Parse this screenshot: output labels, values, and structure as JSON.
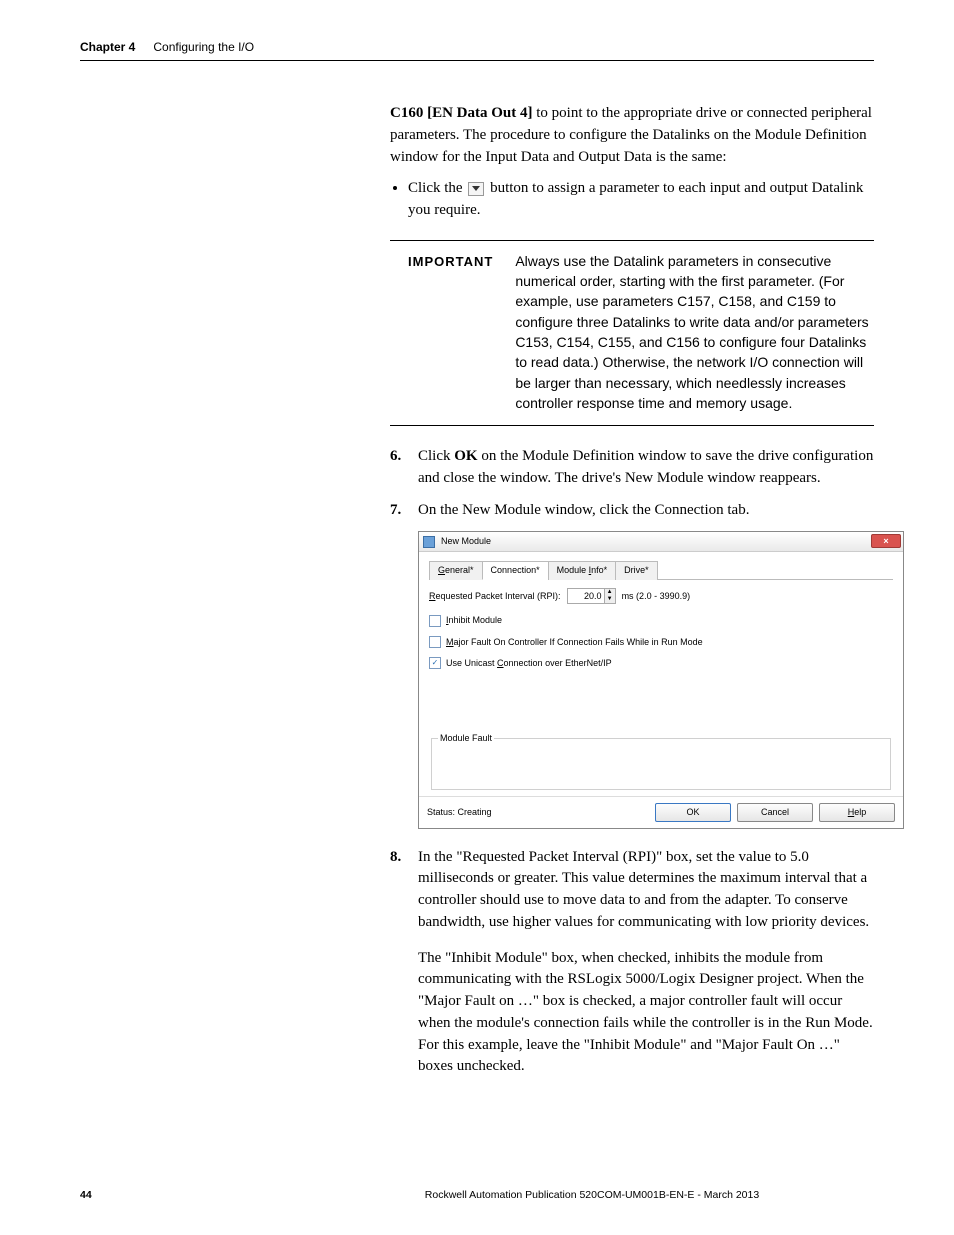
{
  "header": {
    "chapter": "Chapter 4",
    "title": "Configuring the I/O"
  },
  "intro": {
    "prefix": "C160 [EN Data Out 4]",
    "rest": " to point to the appropriate drive or connected peripheral parameters. The procedure to configure the Datalinks on the Module Definition window for the Input Data and Output Data is the same:"
  },
  "bullet": {
    "before": "Click the ",
    "after": " button to assign a parameter to each input and output Datalink you require."
  },
  "important": {
    "label": "IMPORTANT",
    "text": "Always use the Datalink parameters in consecutive numerical order, starting with the first parameter. (For example, use parameters C157, C158, and C159 to configure three Datalinks to write data and/or parameters C153, C154, C155, and C156 to configure four Datalinks to read data.) Otherwise, the network I/O connection will be larger than necessary, which needlessly increases controller response time and memory usage."
  },
  "steps": {
    "s6_before": "Click ",
    "s6_bold": "OK",
    "s6_after": " on the Module Definition window to save the drive configuration and close the window. The drive's New Module window reappears.",
    "s7": "On the New Module window, click the Connection tab.",
    "s8_p1": "In the \"Requested Packet Interval (RPI)\" box, set the value to 5.0 milliseconds or greater. This value determines the maximum interval that a controller should use to move data to and from the adapter. To conserve bandwidth, use higher values for communicating with low priority devices.",
    "s8_p2": "The \"Inhibit Module\" box, when checked, inhibits the module from communicating with the RSLogix 5000/Logix Designer project. When the \"Major Fault on …\" box is checked, a major controller fault will occur when the module's connection fails while the controller is in the Run Mode. For this example, leave the \"Inhibit Module\" and \"Major Fault On …\" boxes unchecked."
  },
  "dialog": {
    "title": "New Module",
    "tabs": {
      "t1": "General*",
      "t2": "Connection*",
      "t3": "Module Info*",
      "t4": "Drive*"
    },
    "rpi_label": "Requested Packet Interval (RPI):",
    "rpi_value": "20.0",
    "rpi_range": "ms (2.0 - 3990.9)",
    "inhibit": "Inhibit Module",
    "major": "Major Fault On Controller If Connection Fails While in Run Mode",
    "unicast": "Use Unicast Connection over EtherNet/IP",
    "fault_group": "Module Fault",
    "status": "Status: Creating",
    "ok": "OK",
    "cancel": "Cancel",
    "help": "Help",
    "close": "×"
  },
  "footer": {
    "page": "44",
    "pub": "Rockwell Automation Publication 520COM-UM001B-EN-E - March 2013"
  }
}
